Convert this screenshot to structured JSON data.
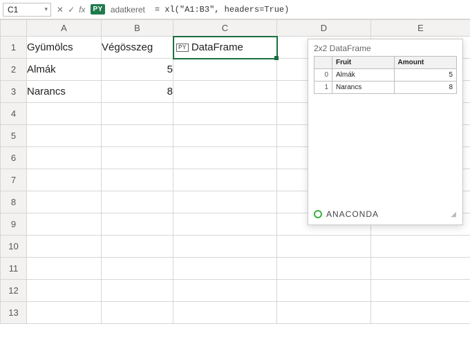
{
  "formula_bar": {
    "cell_ref": "C1",
    "fx_cancel": "✕",
    "fx_confirm": "✓",
    "fx_label": "fx",
    "py_badge": "PY",
    "var_name": "adatkeret",
    "formula": "= xl(\"A1:B3\", headers=True)"
  },
  "columns": [
    "A",
    "B",
    "C",
    "D",
    "E"
  ],
  "rows": [
    "1",
    "2",
    "3",
    "4",
    "5",
    "6",
    "7",
    "8",
    "9",
    "10",
    "11",
    "12",
    "13"
  ],
  "cells": {
    "A1": "Gyümölcs",
    "B1": "Végösszeg",
    "C1_chip": "PY",
    "C1_label": "DataFrame",
    "A2": "Almák",
    "B2": "5",
    "A3": "Narancs",
    "B3": "8"
  },
  "preview": {
    "title": "2x2 DataFrame",
    "headers": {
      "idx": "",
      "col1": "Fruit",
      "col2": "Amount"
    },
    "rows": [
      {
        "idx": "0",
        "fruit": "Almák",
        "amount": "5"
      },
      {
        "idx": "1",
        "fruit": "Narancs",
        "amount": "8"
      }
    ],
    "brand": "ANACONDA"
  }
}
